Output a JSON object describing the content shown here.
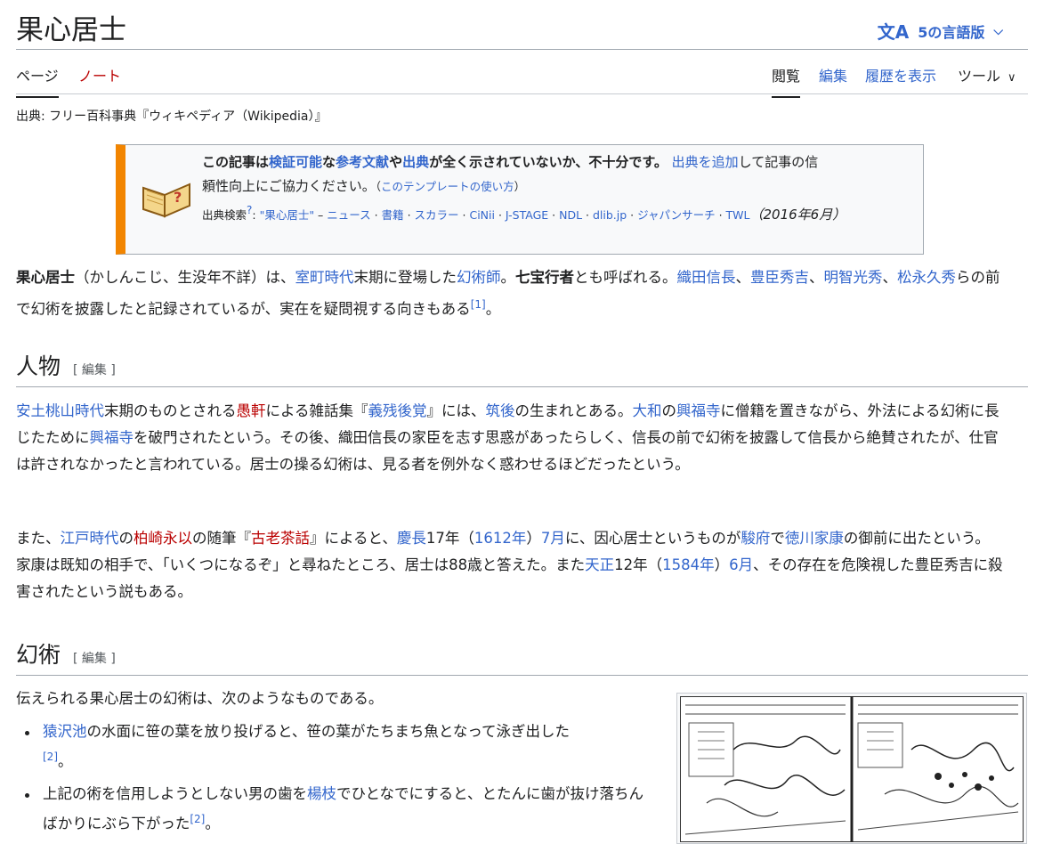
{
  "page": {
    "title": "果心居士"
  },
  "lang_button": {
    "icon": "文A",
    "label": "5の言語版"
  },
  "tabs": {
    "page": "ページ",
    "talk": "ノート",
    "read": "閲覧",
    "edit": "編集",
    "history": "履歴を表示",
    "tools": "ツール"
  },
  "source_line": "出典: フリー百科事典『ウィキペディア（Wikipedia）』",
  "ambox": {
    "t1": "この記事は",
    "t2": "検証可能",
    "t3": "な",
    "t4": "参考文献",
    "t5": "や",
    "t6": "出典",
    "t7": "が全く示されていないか、不十分です。",
    "t8": "出典を追加",
    "t9": "して記事の信",
    "t10": "頼性向上にご協力ください。",
    "t11": "（",
    "t12": "このテンプレートの使い方",
    "t13": "）",
    "s1": "出典検索",
    "s2": "?",
    "s3": ": ",
    "s4": "\"果心居士\"",
    "s5": " – ",
    "s6": "ニュース",
    "s7": " · ",
    "s8": "書籍",
    "s9": "スカラー",
    "s10": "CiNii",
    "s11": "J-STAGE",
    "s12": "NDL",
    "s13": "dlib.jp",
    "s14": "ジャパンサーチ",
    "s15": "TWL",
    "date": "（2016年6月）"
  },
  "intro": {
    "a1": "果心居士",
    "a2": "（かしんこじ、生没年不詳）は、",
    "a3": "室町時代",
    "a4": "末期に登場した",
    "a5": "幻術師",
    "a6": "。",
    "a7": "七宝行者",
    "a8": "とも呼ばれる。",
    "a9": "織田信長",
    "a10": "、",
    "a11": "豊臣秀吉",
    "a12": "明智光秀",
    "a13": "松永久秀",
    "a14": "らの前で幻術を披露したと記録されているが、実在を疑問視する向きもある",
    "a15": "[1]",
    "a16": "。"
  },
  "h_jinbutsu": {
    "title": "人物",
    "edit": "[ 編集 ]"
  },
  "p1": {
    "a1": "安土桃山時代",
    "a2": "末期のものとされる",
    "a3": "愚軒",
    "a4": "による雑話集『",
    "a5": "義残後覚",
    "a6": "』には、",
    "a7": "筑後",
    "a8": "の生まれとある。",
    "a9": "大和",
    "a10": "の",
    "a11": "興福寺",
    "a12": "に僧籍を置きながら、外法による幻術に長じたために",
    "a13": "興福寺",
    "a14": "を破門されたという。その後、織田信長の家臣を志す思惑があったらしく、信長の前で幻術を披露して信長から絶賛されたが、仕官は許されなかったと言われている。居士の操る幻術は、見る者を例外なく惑わせるほどだったという。"
  },
  "p2": {
    "a1": "また、",
    "a2": "江戸時代",
    "a3": "の",
    "a4": "柏崎永以",
    "a5": "の随筆『",
    "a6": "古老茶話",
    "a7": "』によると、",
    "a8": "慶長",
    "a9": "17年（",
    "a10": "1612年",
    "a11": "）",
    "a12": "7月",
    "a13": "に、因心居士というものが",
    "a14": "駿府",
    "a15": "で",
    "a16": "徳川家康",
    "a17": "の御前に出たという。家康は既知の相手で、「いくつになるぞ」と尋ねたところ、居士は88歳と答えた。また",
    "a18": "天正",
    "a19": "12年（",
    "a20": "1584年",
    "a21": "）",
    "a22": "6月",
    "a23": "、その存在を危険視した豊臣秀吉に殺害されたという説もある。"
  },
  "h_genjutsu": {
    "title": "幻術",
    "edit": "[ 編集 ]"
  },
  "p3": "伝えられる果心居士の幻術は、次のようなものである。",
  "list": {
    "i1": {
      "a1": "猿沢池",
      "a2": "の水面に笹の葉を放り投げると、笹の葉がたちまち魚となって泳ぎ出した",
      "a3": "[2]",
      "a4": "。"
    },
    "i2": {
      "a1": "上記の術を信用しようとしない男の歯を",
      "a2": "楊枝",
      "a3": "でひとなでにすると、とたんに歯が抜け落ちんばかりにぶら下がった",
      "a4": "[2]",
      "a5": "。"
    }
  }
}
